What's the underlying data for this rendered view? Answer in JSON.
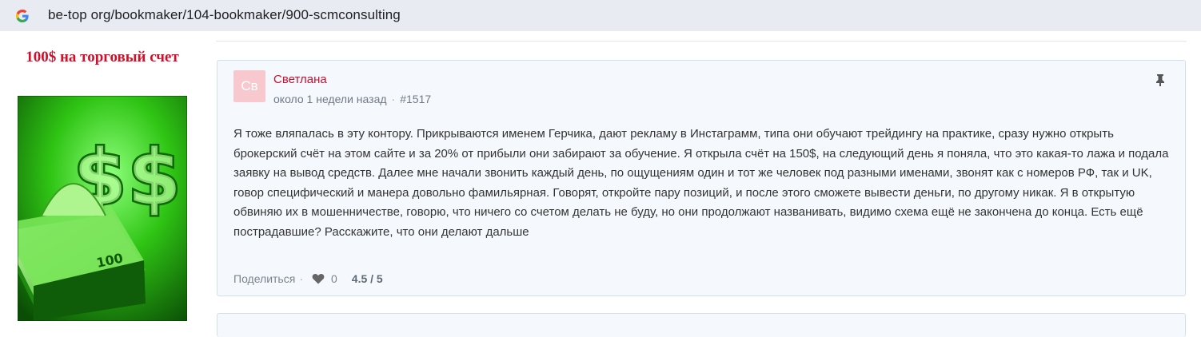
{
  "browser": {
    "url": "be-top org/bookmaker/104-bookmaker/900-scmconsulting",
    "icon": "google-g-icon"
  },
  "sidebar": {
    "promo_title": "100$ на торговый счет",
    "promo_image": "green-dollar-banknotes-image",
    "promo_color": "#d0102a"
  },
  "comment": {
    "avatar_initials": "Св",
    "author": "Светлана",
    "time": "около 1 недели назад",
    "separator": "·",
    "id": "#1517",
    "body": "Я тоже вляпалась в эту контору. Прикрываются именем Герчика, дают рекламу в Инстаграмм, типа они обучают трейдингу на практике, сразу нужно открыть брокерский счёт на этом сайте и за 20% от прибыли они забирают за обучение. Я открыла счёт на 150$, на следующий день я поняла, что это какая-то лажа и подала заявку на вывод средств. Далее мне начали звонить каждый день, по ощущениям один и тот же человек под разными именами, звонят как с номеров РФ, так и UK, говор специфический и манера довольно фамильярная. Говорят, откройте пару позиций, и после этого сможете вывести деньги, по другому никак. Я в открытую обвиняю их в мошенничестве, говорю, что ничего со счетом делать не буду, но они продолжают названивать, видимо схема ещё не закончена до конца. Есть ещё пострадавшие? Расскажите, что они делают дальше",
    "share_label": "Поделиться",
    "like_count": "0",
    "rating": "4.5 / 5",
    "author_color": "#c8102e",
    "avatar_color": "#f7c9ce"
  }
}
